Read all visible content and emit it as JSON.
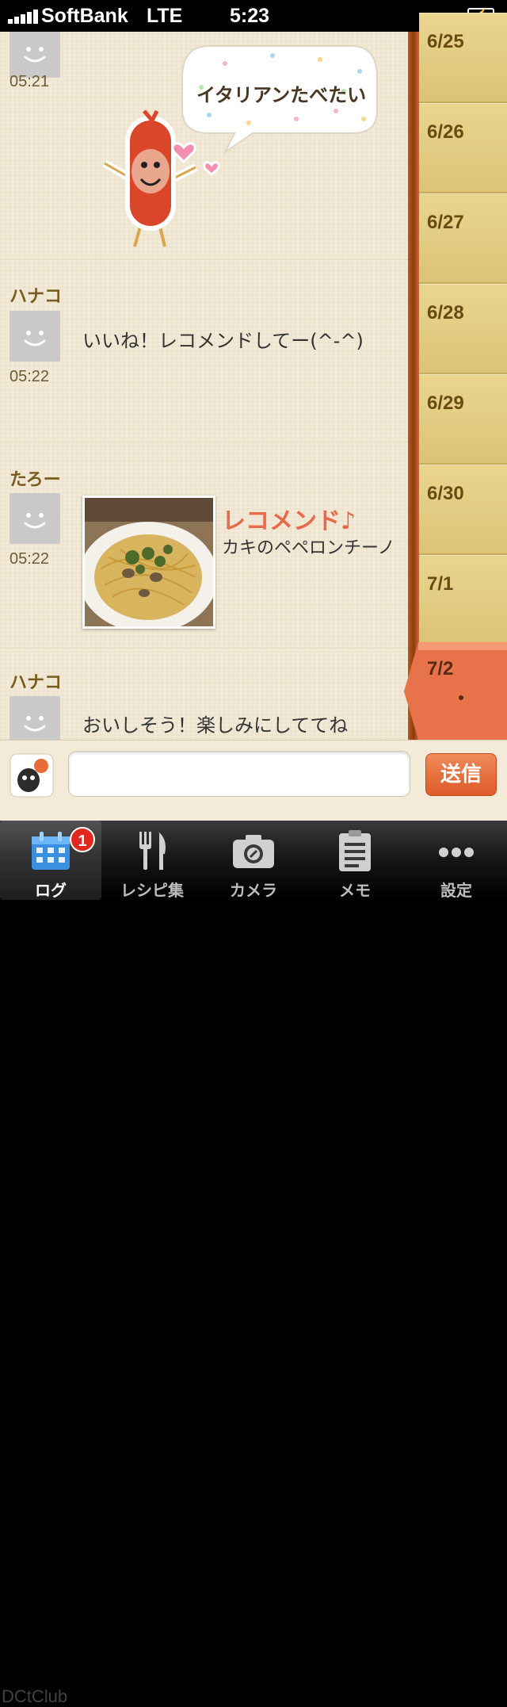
{
  "status_bar": {
    "carrier": "SoftBank",
    "network": "LTE",
    "time": "5:23"
  },
  "chat": {
    "messages": [
      {
        "time": "05:21",
        "bubble_text": "イタリアンたべたい"
      },
      {
        "user": "ハナコ",
        "time": "05:22",
        "text": "いいね！レコメンドしてー(^-^)"
      },
      {
        "user": "たろー",
        "time": "05:22",
        "recommend_label": "レコメンド♪",
        "recipe_name": "カキのペペロンチーノ"
      },
      {
        "user": "ハナコ",
        "text": "おいしそう！楽しみにしててね"
      }
    ]
  },
  "dates": [
    "6/25",
    "6/26",
    "6/27",
    "6/28",
    "6/29",
    "6/30",
    "7/1"
  ],
  "active_date": "7/2",
  "input": {
    "placeholder": "",
    "send_label": "送信"
  },
  "tabs": [
    {
      "label": "ログ",
      "icon": "calendar-icon",
      "badge": "1"
    },
    {
      "label": "レシピ集",
      "icon": "fork-knife-icon"
    },
    {
      "label": "カメラ",
      "icon": "camera-icon"
    },
    {
      "label": "メモ",
      "icon": "clipboard-icon"
    },
    {
      "label": "設定",
      "icon": "more-dots-icon"
    }
  ],
  "watermark": "DCtClub",
  "colors": {
    "accent": "#e86a4a",
    "active_date": "#e8734a",
    "date_column": "#e5cd86",
    "chat_background": "#f2ead7"
  }
}
